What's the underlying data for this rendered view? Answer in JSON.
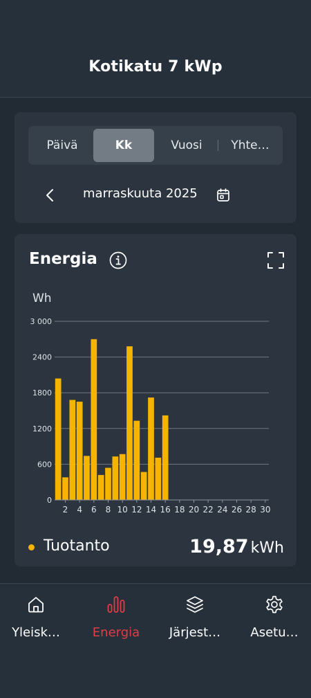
{
  "header": {
    "title": "Kotikatu 7 kWp"
  },
  "period_tabs": [
    {
      "label": "Päivä",
      "active": false
    },
    {
      "label": "Kk",
      "active": true
    },
    {
      "label": "Vuosi",
      "active": false
    },
    {
      "label": "Yhte…",
      "active": false
    }
  ],
  "date_nav": {
    "label": "marraskuuta 2025"
  },
  "energy": {
    "title": "Energia",
    "legend_label": "Tuotanto",
    "total_value": "19,87",
    "total_unit": "kWh"
  },
  "chart_data": {
    "type": "bar",
    "ylabel": "Wh",
    "ylim": [
      0,
      3000
    ],
    "y_ticks": [
      "0",
      "600",
      "1200",
      "1800",
      "2400",
      "3 000"
    ],
    "y_tick_values": [
      0,
      600,
      1200,
      1800,
      2400,
      3000
    ],
    "x_tick_labels": [
      "2",
      "4",
      "6",
      "8",
      "10",
      "12",
      "14",
      "16",
      "18",
      "20",
      "22",
      "24",
      "26",
      "28",
      "30"
    ],
    "categories": [
      1,
      2,
      3,
      4,
      5,
      6,
      7,
      8,
      9,
      10,
      11,
      12,
      13,
      14,
      15,
      16,
      17,
      18,
      19,
      20,
      21,
      22,
      23,
      24,
      25,
      26,
      27,
      28,
      29,
      30
    ],
    "series": [
      {
        "color": "#f5b400",
        "values": [
          2040,
          380,
          1680,
          1650,
          740,
          2700,
          420,
          540,
          730,
          770,
          2580,
          1330,
          470,
          1720,
          710,
          1420,
          0,
          0,
          0,
          0,
          0,
          0,
          0,
          0,
          0,
          0,
          0,
          0,
          0,
          0
        ]
      }
    ],
    "grid": true,
    "legend": "bottom-left"
  },
  "bottom_nav": [
    {
      "label": "Yleisk…",
      "icon": "home-icon",
      "active": false
    },
    {
      "label": "Energia",
      "icon": "bar-chart-icon",
      "active": true
    },
    {
      "label": "Järjest…",
      "icon": "layers-icon",
      "active": false
    },
    {
      "label": "Asetu…",
      "icon": "gear-icon",
      "active": false
    }
  ],
  "colors": {
    "accent": "#f5b400",
    "active_nav": "#e23c45",
    "background": "#222a33",
    "card": "#2b343f"
  }
}
